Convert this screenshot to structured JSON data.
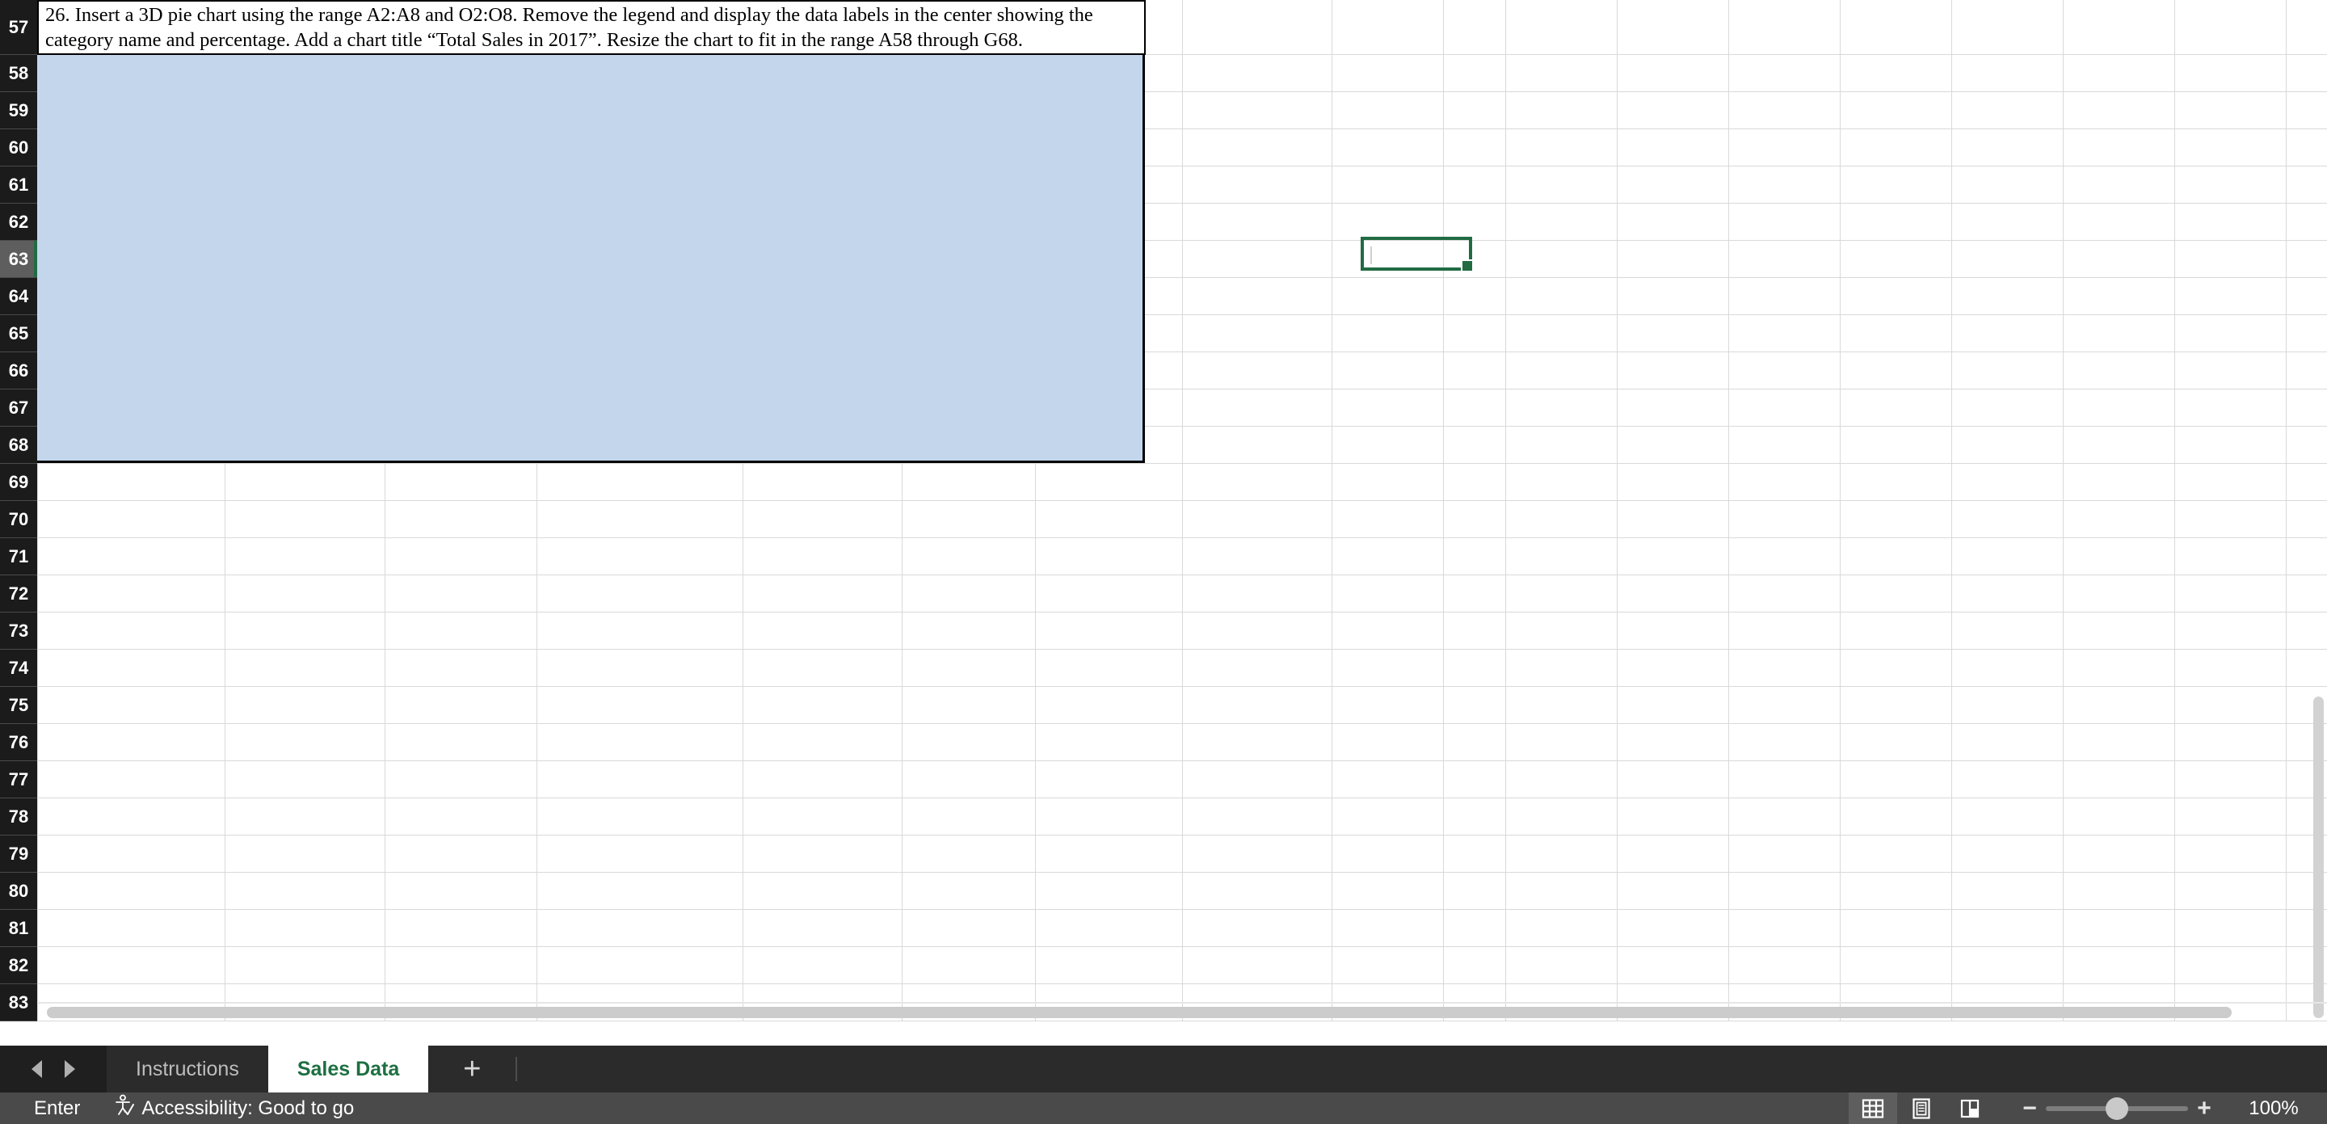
{
  "workbook": {
    "instruction_cell": {
      "row": "57",
      "text": "26. Insert a 3D pie chart using the range A2:A8 and O2:O8. Remove the legend and display the data labels in the center showing the category name and percentage. Add a chart title “Total Sales in 2017”. Resize the chart to fit in the range A58 through G68."
    },
    "chart_placeholder": {
      "label": "chart-area-placeholder",
      "fill_color": "#c3d6ec"
    },
    "rows": [
      "57",
      "58",
      "59",
      "60",
      "61",
      "62",
      "63",
      "64",
      "65",
      "66",
      "67",
      "68",
      "69",
      "70",
      "71",
      "72",
      "73",
      "74",
      "75",
      "76",
      "77",
      "78",
      "79",
      "80",
      "81",
      "82",
      "83"
    ],
    "active_row": "63",
    "active_cell": {
      "border_color": "#216b43"
    }
  },
  "tab_bar": {
    "prev_arrow": "previous-sheet-arrow",
    "next_arrow": "next-sheet-arrow",
    "tabs": [
      {
        "label": "Instructions",
        "active": false
      },
      {
        "label": "Sales Data",
        "active": true
      }
    ],
    "add_sheet_label": "+"
  },
  "status_bar": {
    "mode": "Enter",
    "accessibility": "Accessibility: Good to go",
    "view_buttons": [
      {
        "name": "normal-view",
        "selected": true
      },
      {
        "name": "page-layout-view",
        "selected": false
      },
      {
        "name": "page-break-preview",
        "selected": false
      }
    ],
    "zoom_out_label": "−",
    "zoom_in_label": "+",
    "zoom_level": "100%"
  },
  "colors": {
    "accent_green": "#1d6f42",
    "selection_green": "#216b43",
    "chart_fill": "#c3d6ec",
    "header_dark": "#1b1b1b",
    "status_bg": "#4a4a4a",
    "tab_bg": "#2b2b2b"
  }
}
